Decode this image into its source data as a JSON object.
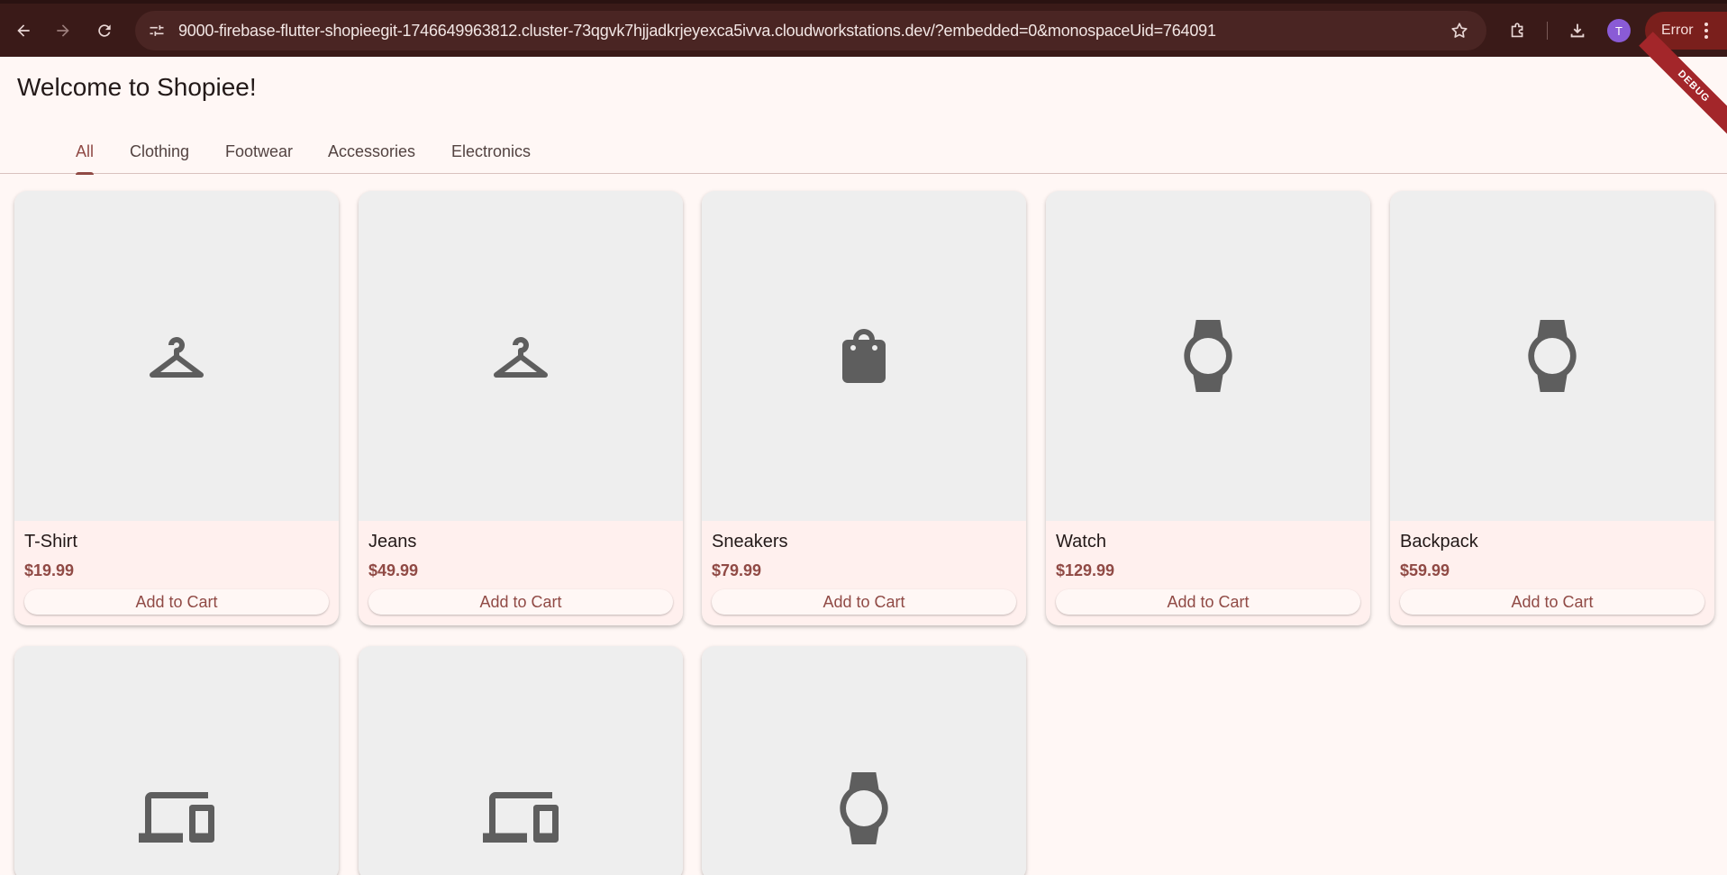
{
  "browser": {
    "url": "9000-firebase-flutter-shopieegit-1746649963812.cluster-73qgvk7hjjadkrjeyexca5ivva.cloudworkstations.dev/?embedded=0&monospaceUid=764091",
    "avatar_initial": "T",
    "error_label": "Error"
  },
  "app": {
    "title": "Welcome to Shopiee!",
    "debug_banner": "DEBUG",
    "tabs": [
      {
        "label": "All",
        "active": true
      },
      {
        "label": "Clothing",
        "active": false
      },
      {
        "label": "Footwear",
        "active": false
      },
      {
        "label": "Accessories",
        "active": false
      },
      {
        "label": "Electronics",
        "active": false
      }
    ],
    "add_to_cart_label": "Add to Cart",
    "products": [
      {
        "name": "T-Shirt",
        "price": "$19.99",
        "icon": "hanger-icon"
      },
      {
        "name": "Jeans",
        "price": "$49.99",
        "icon": "hanger-icon"
      },
      {
        "name": "Sneakers",
        "price": "$79.99",
        "icon": "shopping-bag-icon"
      },
      {
        "name": "Watch",
        "price": "$129.99",
        "icon": "watch-icon"
      },
      {
        "name": "Backpack",
        "price": "$59.99",
        "icon": "watch-icon"
      },
      {
        "icon": "devices-icon"
      },
      {
        "icon": "devices-icon"
      },
      {
        "icon": "watch-icon"
      }
    ]
  },
  "colors": {
    "primary": "#904a45",
    "background": "#fff7f5",
    "card": "#fff0ee",
    "chrome": "#3a1a18"
  }
}
